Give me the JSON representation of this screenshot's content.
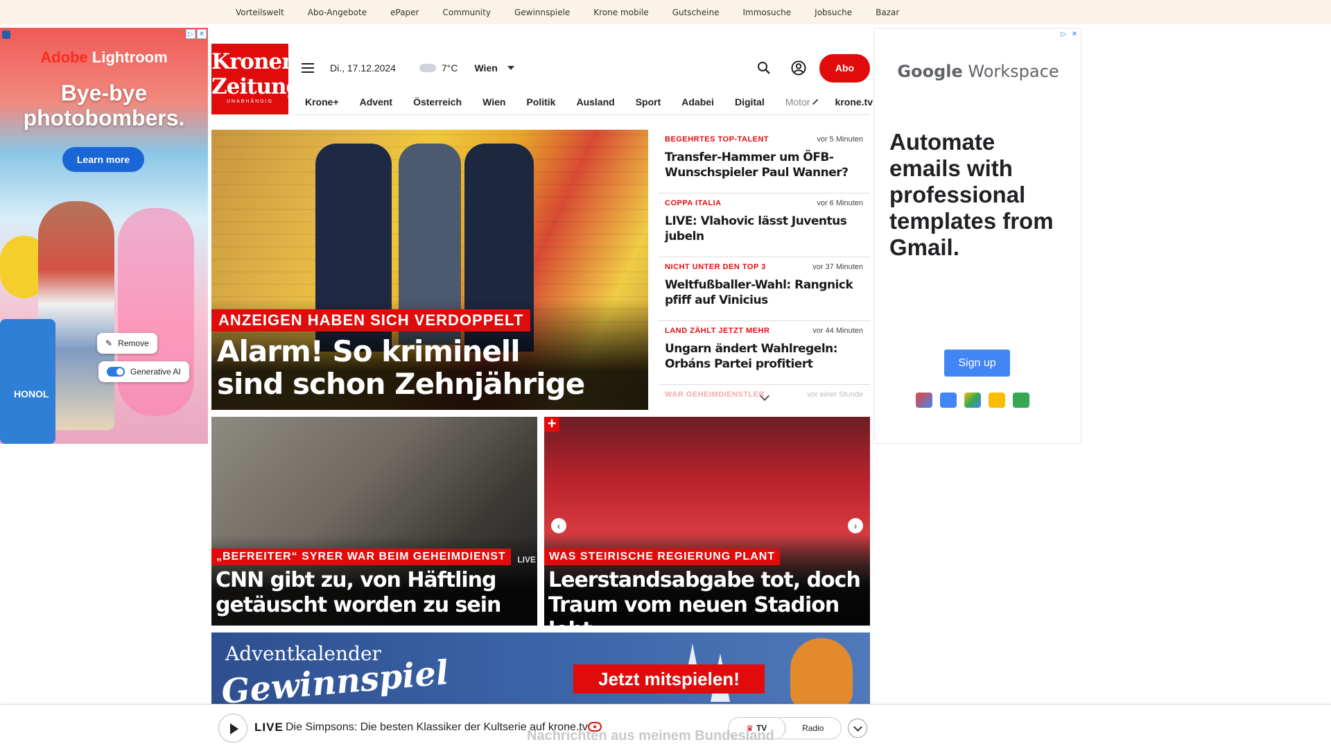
{
  "topbar": {
    "links": [
      "Vorteilswelt",
      "Abo-Angebote",
      "ePaper",
      "Community",
      "Gewinnspiele",
      "Krone mobile",
      "Gutscheine",
      "Immosuche",
      "Jobsuche",
      "Bazar"
    ]
  },
  "ad_left": {
    "brand_a": "Adobe",
    "brand_b": "Lightroom",
    "headline_1": "Bye-bye",
    "headline_2": "photobombers.",
    "cta": "Learn more",
    "tub_text": "HONOL",
    "chip_remove": "Remove",
    "chip_ai": "Generative AI",
    "badge_icon": "adchoices-icon",
    "close_icon": "close-icon"
  },
  "ad_right": {
    "logo_google": "Google",
    "logo_product": "Workspace",
    "headline": "Automate emails with professional templates from Gmail.",
    "cta": "Sign up"
  },
  "header": {
    "logo_line1": "Kronen",
    "logo_line2": "Zeitung",
    "logo_line3": "UNABHÄNGIG",
    "date": "Di., 17.12.2024",
    "temperature": "7°C",
    "city": "Wien",
    "abo": "Abo"
  },
  "nav": {
    "items": [
      "Krone+",
      "Advent",
      "Österreich",
      "Wien",
      "Politik",
      "Ausland",
      "Sport",
      "Adabei",
      "Digital"
    ],
    "truncated": "Motor",
    "tv": "krone.tv"
  },
  "hero": {
    "kicker": "ANZEIGEN HABEN SICH VERDOPPELT",
    "headline_1": "Alarm! So kriminell",
    "headline_2": "sind schon Zehnjährige"
  },
  "ticker": [
    {
      "category": "BEGEHRTES TOP-TALENT",
      "time": "vor 5 Minuten",
      "title": "Transfer-Hammer um ÖFB-Wunschspieler Paul Wanner?"
    },
    {
      "category": "COPPA ITALIA",
      "time": "vor 6 Minuten",
      "title": "LIVE: Vlahovic lässt Juventus jubeln"
    },
    {
      "category": "NICHT UNTER DEN TOP 3",
      "time": "vor 37 Minuten",
      "title": "Weltfußballer-Wahl: Rangnick pfiff auf Vinicius"
    },
    {
      "category": "LAND ZÄHLT JETZT MEHR",
      "time": "vor 44 Minuten",
      "title": "Ungarn ändert Wahlregeln: Orbáns Partei profitiert"
    },
    {
      "category": "WAR GEHEIMDIENSTLER",
      "time": "vor einer Stunde",
      "title": ""
    }
  ],
  "cards": [
    {
      "kicker": "„BEFREITER“ SYRER WAR BEIM GEHEIMDIENST",
      "headline_1": "CNN gibt zu, von Häftling",
      "headline_2": "getäuscht worden zu sein",
      "badge": "LIVE"
    },
    {
      "kicker": "WAS STEIRISCHE REGIERUNG PLANT",
      "headline_1": "Leerstandsabgabe tot, doch",
      "headline_2": "Traum vom neuen Stadion lebt",
      "plus": "+"
    }
  ],
  "banner": {
    "line1": "Adventkalender",
    "line2": "Gewinnspiel",
    "cta": "Jetzt mitspielen!"
  },
  "player": {
    "live_label": "LIVE",
    "live_text": "Die Simpsons: Die besten Klassiker der Kultserie auf krone.tv",
    "tab_tv": "TV",
    "tab_radio": "Radio",
    "below_text": "Nachrichten aus meinem Bundesland"
  }
}
